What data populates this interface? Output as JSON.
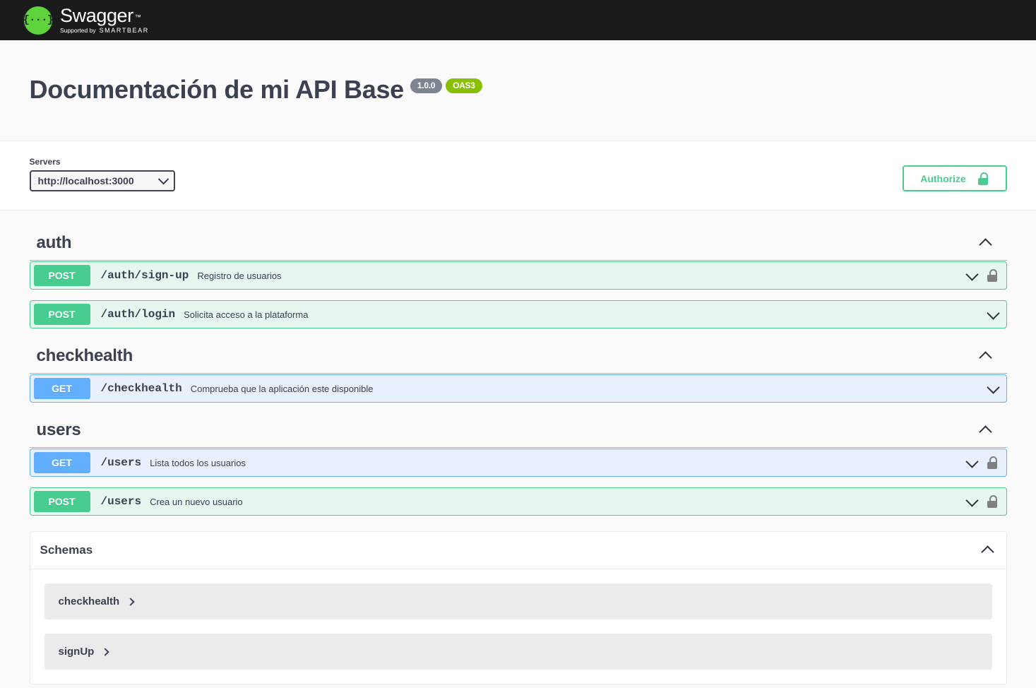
{
  "topbar": {
    "logo_glyph": "{···}",
    "brand": "Swagger",
    "trademark": "™",
    "supported_by_label": "Supported by",
    "supported_by_name": "SMARTBEAR"
  },
  "header": {
    "title": "Documentación de mi API Base",
    "version_badge": "1.0.0",
    "spec_badge": "OAS3"
  },
  "servers": {
    "label": "Servers",
    "selected": "http://localhost:3000",
    "options": [
      "http://localhost:3000"
    ],
    "chevron_icon": "chevron-down-icon"
  },
  "authorize": {
    "label": "Authorize",
    "icon": "unlock-icon"
  },
  "colors": {
    "post": "#49cc90",
    "get": "#61affe",
    "post_bg": "#e8f6f0",
    "get_bg": "#e8f0fb",
    "version_badge": "#7d8492",
    "oas_badge": "#89bf04",
    "lock": "#808080",
    "topbar": "#1b1b1b",
    "page_bg": "#fafafa"
  },
  "tags": [
    {
      "name": "auth",
      "collapse_icon": "chevron-up-icon",
      "operations": [
        {
          "method": "POST",
          "method_class": "post",
          "path": "/auth/sign-up",
          "summary": "Registro de usuarios",
          "expand_icon": "chevron-down-icon",
          "has_lock": true
        },
        {
          "method": "POST",
          "method_class": "post",
          "path": "/auth/login",
          "summary": "Solicita acceso a la plataforma",
          "expand_icon": "chevron-down-icon",
          "has_lock": false
        }
      ]
    },
    {
      "name": "checkhealth",
      "collapse_icon": "chevron-up-icon",
      "operations": [
        {
          "method": "GET",
          "method_class": "get",
          "path": "/checkhealth",
          "summary": "Comprueba que la aplicación este disponible",
          "expand_icon": "chevron-down-icon",
          "has_lock": false
        }
      ]
    },
    {
      "name": "users",
      "collapse_icon": "chevron-up-icon",
      "operations": [
        {
          "method": "GET",
          "method_class": "get",
          "path": "/users",
          "summary": "Lista todos los usuarios",
          "expand_icon": "chevron-down-icon",
          "has_lock": true
        },
        {
          "method": "POST",
          "method_class": "post",
          "path": "/users",
          "summary": "Crea un nuevo usuario",
          "expand_icon": "chevron-down-icon",
          "has_lock": true
        }
      ]
    }
  ],
  "schemas": {
    "title": "Schemas",
    "collapse_icon": "chevron-up-icon",
    "items": [
      {
        "name": "checkhealth",
        "expand_icon": "chevron-right-icon"
      },
      {
        "name": "signUp",
        "expand_icon": "chevron-right-icon"
      }
    ]
  }
}
